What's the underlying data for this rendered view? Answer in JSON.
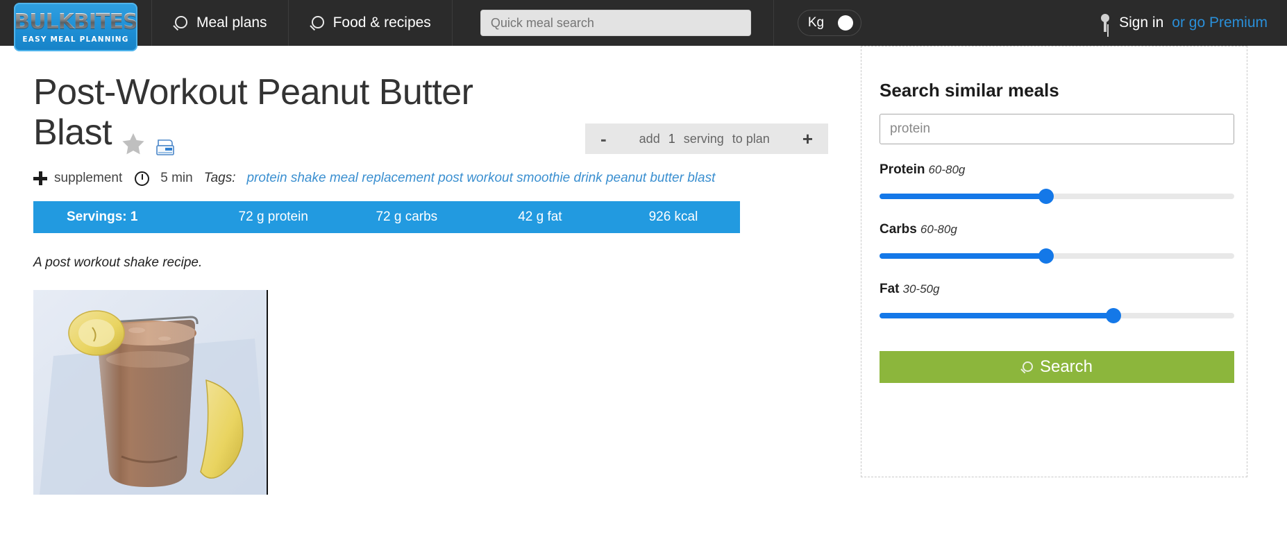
{
  "header": {
    "logo": {
      "main": "BULKBITES",
      "sub": "EASY MEAL PLANNING"
    },
    "nav": [
      {
        "label": "Meal plans",
        "icon": "search-icon"
      },
      {
        "label": "Food & recipes",
        "icon": "search-icon"
      }
    ],
    "search": {
      "placeholder": "Quick meal search",
      "value": ""
    },
    "unit_toggle": {
      "label": "Kg"
    },
    "account": {
      "signin": "Sign in",
      "premium": "or go Premium",
      "icon": "key-icon"
    },
    "bg_color": "#2b2b2b"
  },
  "recipe": {
    "title": "Post-Workout Peanut Butter Blast",
    "favorite_icon": "star-icon",
    "print_icon": "print-icon",
    "serving_control": {
      "minus": "-",
      "add": "add",
      "quantity": "1",
      "serving": "serving",
      "to_plan": "to plan",
      "plus": "+"
    },
    "meta": {
      "type": "supplement",
      "time": "5 min",
      "tags_label": "Tags:",
      "tags": "protein shake meal replacement post workout smoothie drink peanut butter blast"
    },
    "nutrition": {
      "servings": "Servings: 1",
      "protein": "72 g protein",
      "carbs": "72 g carbs",
      "fat": "42 g fat",
      "kcal": "926 kcal",
      "bar_color": "#229ae0"
    },
    "description": "A post workout shake recipe.",
    "photo_alt": "chocolate peanut butter smoothie in a glass with banana slice"
  },
  "sidebar": {
    "title": "Search similar meals",
    "query": {
      "value": "protein",
      "placeholder": "protein"
    },
    "sliders": [
      {
        "name": "Protein",
        "range": "60-80g",
        "percent": 47
      },
      {
        "name": "Carbs",
        "range": "60-80g",
        "percent": 47
      },
      {
        "name": "Fat",
        "range": "30-50g",
        "percent": 66
      }
    ],
    "search_button": {
      "label": "Search",
      "icon": "search-icon",
      "color": "#8cb63c"
    },
    "slider_color": "#1478e8"
  }
}
